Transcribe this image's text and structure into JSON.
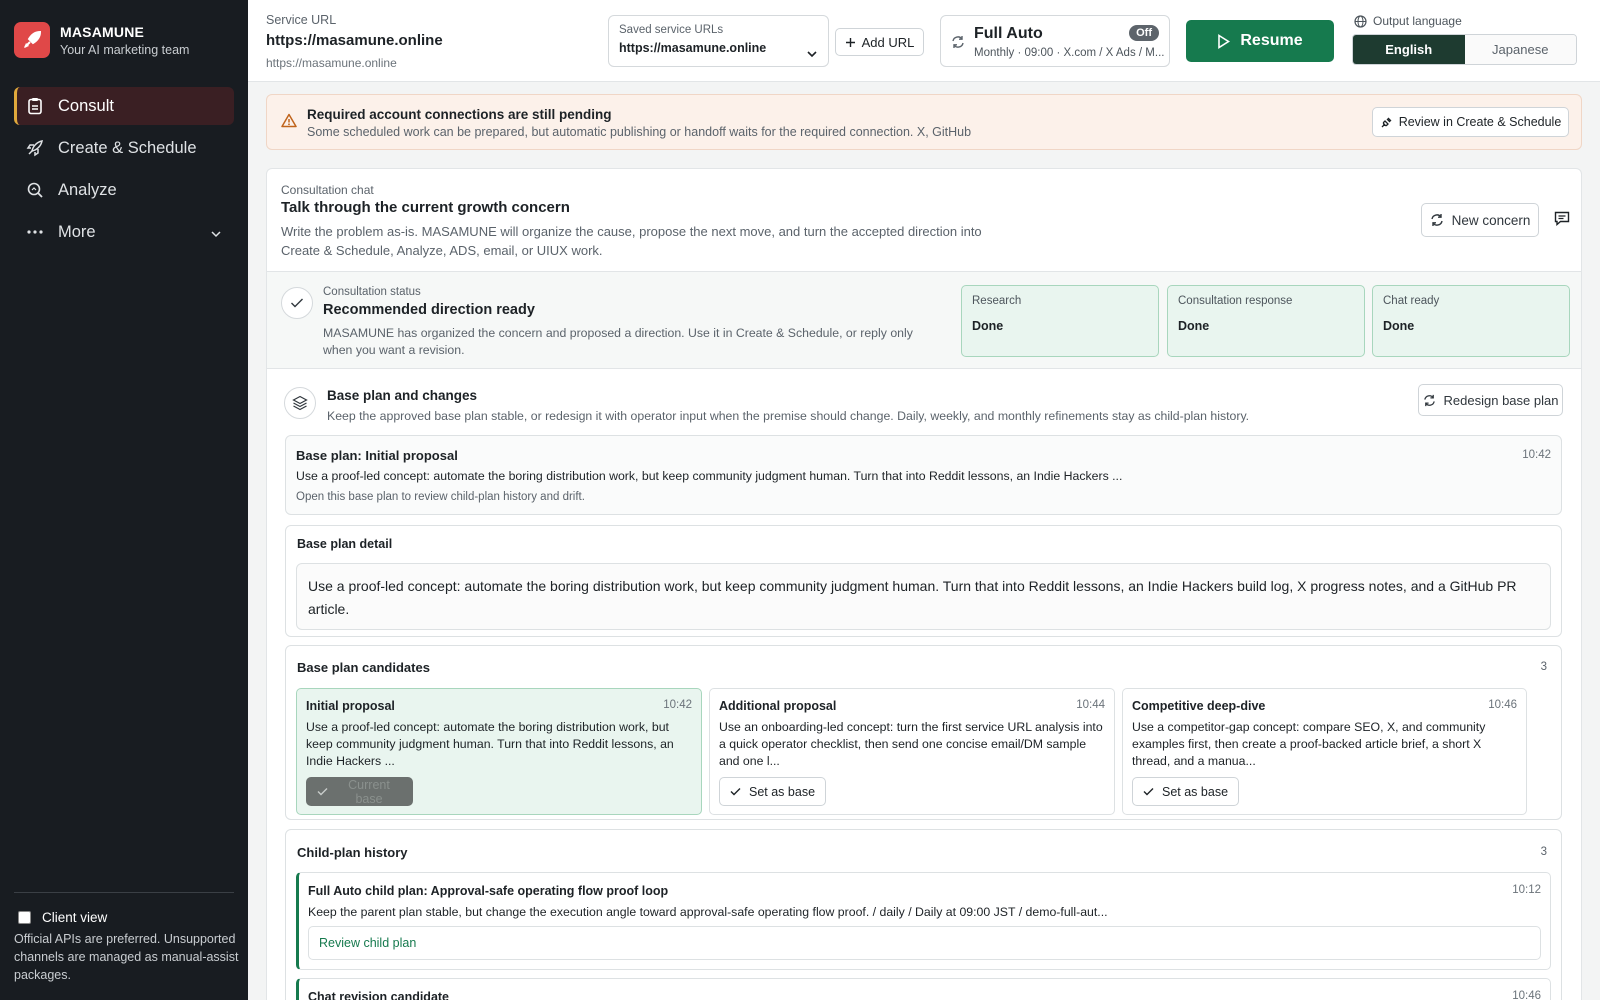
{
  "brand": {
    "name": "MASAMUNE",
    "tagline": "Your AI marketing team"
  },
  "nav": [
    {
      "label": "Consult",
      "icon": "clipboard-icon",
      "active": true
    },
    {
      "label": "Create & Schedule",
      "icon": "rocket-icon"
    },
    {
      "label": "Analyze",
      "icon": "magnify-icon"
    },
    {
      "label": "More",
      "icon": "more-dots-icon"
    }
  ],
  "client_view": {
    "label": "Client view",
    "note": "Official APIs are preferred. Unsupported channels are managed as manual-assist packages."
  },
  "header": {
    "service_url_label": "Service URL",
    "service_url": "https://masamune.online",
    "service_url_sub": "https://masamune.online",
    "saved_label": "Saved service URLs",
    "saved_value": "https://masamune.online",
    "add_url": "Add URL",
    "full_auto_title": "Full Auto",
    "full_auto_sub": "Monthly · 09:00 · X.com / X Ads / M...",
    "full_auto_state": "Off",
    "resume": "Resume",
    "output_language_label": "Output language",
    "languages": [
      "English",
      "Japanese"
    ],
    "selected_language": "English"
  },
  "warning": {
    "title": "Required account connections are still pending",
    "text": "Some scheduled work can be prepared, but automatic publishing or handoff waits for the required connection. X, GitHub",
    "button": "Review in Create & Schedule"
  },
  "consult": {
    "label": "Consultation chat",
    "title": "Talk through the current growth concern",
    "desc": "Write the problem as-is. MASAMUNE will organize the cause, propose the next move, and turn the accepted direction into Create & Schedule, Analyze, ADS, email, or UIUX work.",
    "new_concern": "New concern"
  },
  "status": {
    "label": "Consultation status",
    "title": "Recommended direction ready",
    "desc": "MASAMUNE has organized the concern and proposed a direction. Use it in Create & Schedule, or reply only when you want a revision.",
    "cards": [
      {
        "label": "Research",
        "value": "Done"
      },
      {
        "label": "Consultation response",
        "value": "Done"
      },
      {
        "label": "Chat ready",
        "value": "Done"
      }
    ]
  },
  "base_plan": {
    "title": "Base plan and changes",
    "desc": "Keep the approved base plan stable, or redesign it with operator input when the premise should change. Daily, weekly, and monthly refinements stay as child-plan history.",
    "redesign": "Redesign base plan",
    "current": {
      "title": "Base plan: Initial proposal",
      "time": "10:42",
      "text": "Use a proof-led concept: automate the boring distribution work, but keep community judgment human. Turn that into Reddit lessons, an Indie Hackers ...",
      "hint": "Open this base plan to review child-plan history and drift."
    },
    "detail_title": "Base plan detail",
    "detail_text": "Use a proof-led concept: automate the boring distribution work, but keep community judgment human. Turn that into Reddit lessons, an Indie Hackers build log, X progress notes, and a GitHub PR article.",
    "candidates_title": "Base plan candidates",
    "candidates_count": "3",
    "candidates": [
      {
        "name": "Initial proposal",
        "time": "10:42",
        "text": "Use a proof-led concept: automate the boring distribution work, but keep community judgment human. Turn that into Reddit lessons, an Indie Hackers ...",
        "button": "Current base",
        "selected": true
      },
      {
        "name": "Additional proposal",
        "time": "10:44",
        "text": "Use an onboarding-led concept: turn the first service URL analysis into a quick operator checklist, then send one concise email/DM sample and one l...",
        "button": "Set as base"
      },
      {
        "name": "Competitive deep-dive",
        "time": "10:46",
        "text": "Use a competitor-gap concept: compare SEO, X, and community examples first, then create a proof-backed article brief, a short X thread, and a manua...",
        "button": "Set as base"
      }
    ],
    "child_title": "Child-plan history",
    "child_count": "3",
    "children": [
      {
        "title": "Full Auto child plan: Approval-safe operating flow proof loop",
        "time": "10:12",
        "text": "Keep the parent plan stable, but change the execution angle toward approval-safe operating flow proof. / daily / Daily at 09:00 JST / demo-full-aut...",
        "action": "Review child plan"
      },
      {
        "title": "Chat revision candidate",
        "time": "10:46"
      }
    ]
  }
}
